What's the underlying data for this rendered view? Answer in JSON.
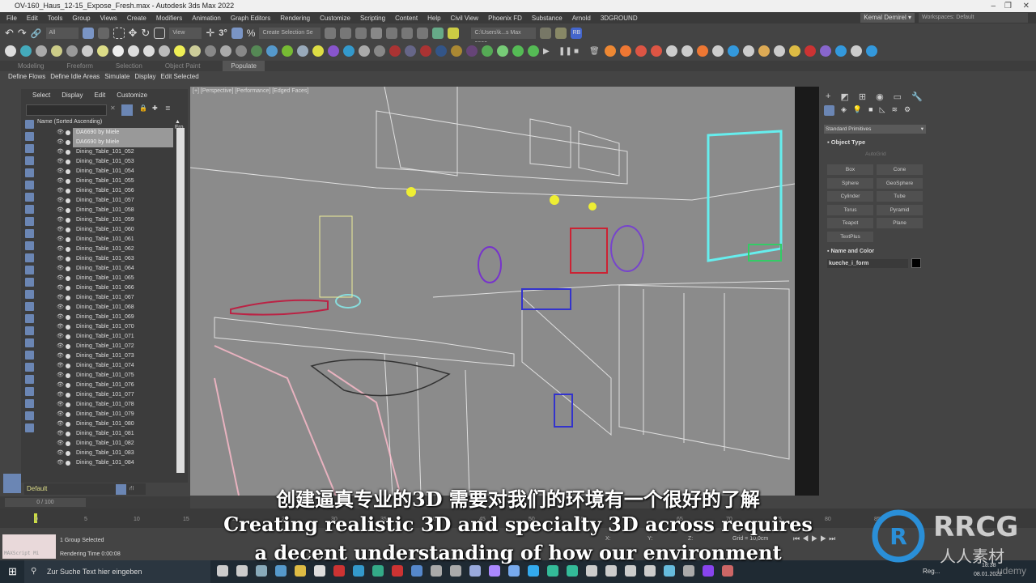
{
  "window": {
    "title": "OV-160_Haus_12-15_Expose_Fresh.max - Autodesk 3ds Max 2022",
    "minimize": "–",
    "maximize": "❐",
    "close": "✕"
  },
  "menu": [
    "File",
    "Edit",
    "Tools",
    "Group",
    "Views",
    "Create",
    "Modifiers",
    "Animation",
    "Graph Editors",
    "Rendering",
    "Customize",
    "Scripting",
    "Content",
    "Help",
    "Civil View",
    "Phoenix FD",
    "Substance",
    "Arnold",
    "3DGROUND"
  ],
  "user": "Kemal Demirel ▾",
  "workspace": "Workspaces: Default",
  "toolbar": {
    "filter": "All",
    "ref_coord": "View",
    "selection_set": "Create Selection Se",
    "project_path": "C:\\Users\\k...s Max 2022",
    "rb": "RB"
  },
  "ribbon": {
    "tabs": [
      "Modeling",
      "Freeform",
      "Selection",
      "Object Paint",
      "Populate"
    ],
    "active": "Populate",
    "sub": [
      "Define Flows",
      "Define Idle Areas",
      "Simulate",
      "Display",
      "Edit Selected"
    ]
  },
  "explorer": {
    "menu": [
      "Select",
      "Display",
      "Edit",
      "Customize"
    ],
    "column": "Name (Sorted Ascending)",
    "column2": "▲ Fro",
    "items": [
      "DA6690 by Miele",
      "DA6690 by Miele",
      "Dining_Table_101_052",
      "Dining_Table_101_053",
      "Dining_Table_101_054",
      "Dining_Table_101_055",
      "Dining_Table_101_056",
      "Dining_Table_101_057",
      "Dining_Table_101_058",
      "Dining_Table_101_059",
      "Dining_Table_101_060",
      "Dining_Table_101_061",
      "Dining_Table_101_062",
      "Dining_Table_101_063",
      "Dining_Table_101_064",
      "Dining_Table_101_065",
      "Dining_Table_101_066",
      "Dining_Table_101_067",
      "Dining_Table_101_068",
      "Dining_Table_101_069",
      "Dining_Table_101_070",
      "Dining_Table_101_071",
      "Dining_Table_101_072",
      "Dining_Table_101_073",
      "Dining_Table_101_074",
      "Dining_Table_101_075",
      "Dining_Table_101_076",
      "Dining_Table_101_077",
      "Dining_Table_101_078",
      "Dining_Table_101_079",
      "Dining_Table_101_080",
      "Dining_Table_101_081",
      "Dining_Table_101_082",
      "Dining_Table_101_083",
      "Dining_Table_101_084"
    ],
    "layer": "Default"
  },
  "viewport": {
    "label": "[+] [Perspective] [Performance] [Edged Faces]"
  },
  "command_panel": {
    "category": "Standard Primitives",
    "object_type": "Object Type",
    "autogrid": "AutoGrid",
    "buttons": [
      "Box",
      "Cone",
      "Sphere",
      "GeoSphere",
      "Cylinder",
      "Tube",
      "Torus",
      "Pyramid",
      "Teapot",
      "Plane",
      "TextPlus"
    ],
    "name_color": "Name and Color",
    "object_name": "kueche_i_form",
    "object_color": "#000000"
  },
  "timeline": {
    "frame": "0 / 100",
    "ticks": [
      "0",
      "5",
      "10",
      "15",
      "20",
      "25",
      "30",
      "35",
      "40",
      "45",
      "50",
      "55",
      "60",
      "65",
      "70",
      "75",
      "80",
      "85"
    ]
  },
  "status": {
    "selected": "1 Group Selected",
    "render_time": "Rendering Time  0:00:08",
    "maxscript": "MAXScript Mi",
    "x": "X:",
    "y": "Y:",
    "z": "Z:",
    "grid": "Grid = 10,0cm"
  },
  "subtitles": {
    "zh": "创建逼真专业的3D 需要对我们的环境有一个很好的了解",
    "en1": "Creating realistic 3D and specialty 3D across requires",
    "en2": "a decent understanding of how our environment"
  },
  "taskbar": {
    "search": "Zur Suche Text hier eingeben",
    "weather": "Reg...",
    "time": "18:38",
    "date": "08.01.2022"
  },
  "watermark": {
    "logo": "RRCG",
    "logo_cn": "人人素材",
    "udemy": "udemy"
  }
}
